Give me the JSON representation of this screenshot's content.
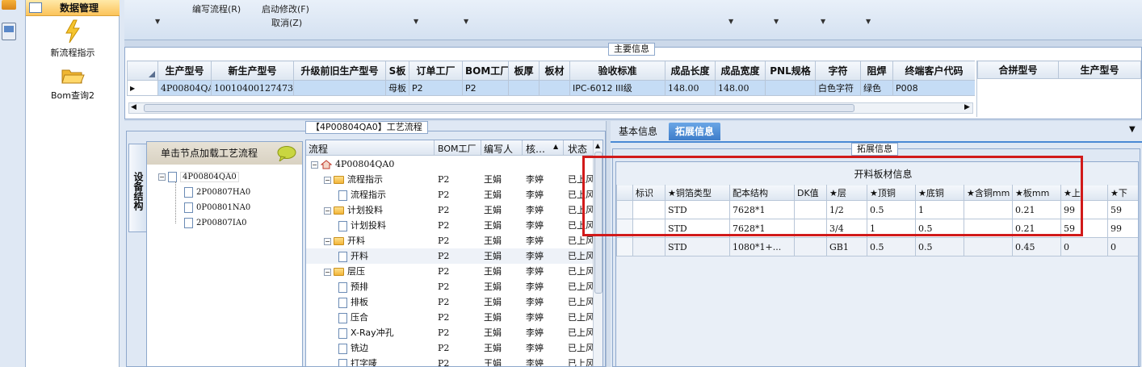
{
  "nav": {
    "header": "数据管理",
    "items": [
      {
        "label": "新流程指示",
        "icon": "lightning-icon"
      },
      {
        "label": "Bom查询2",
        "icon": "folder-open-icon"
      }
    ]
  },
  "ribbon": {
    "items": [
      "编写流程(R)",
      "启动修改(F)",
      "取消(Z)"
    ]
  },
  "main_info": {
    "title": "主要信息",
    "columns": [
      "生产型号",
      "新生产型号",
      "升级前旧生产型号",
      "S板",
      "订单工厂",
      "BOM工厂",
      "板厚",
      "板材",
      "验收标准",
      "成品长度",
      "成品宽度",
      "PNL规格",
      "字符",
      "阻焊",
      "终端客户代码"
    ],
    "row": [
      "4P00804QA0",
      "10010400127473",
      "",
      "母板",
      "P2",
      "P2",
      "",
      "",
      "IPC-6012 III级",
      "148.00",
      "148.00",
      "",
      "白色字符",
      "绿色",
      "P008"
    ],
    "right_columns": [
      "合拼型号",
      "生产型号"
    ]
  },
  "process": {
    "title": "【4P00804QA0】工艺流程",
    "side_tab": "设备结构",
    "load_label": "单击节点加载工艺流程",
    "tree_root": "4P00804QA0",
    "tree_children": [
      "2P00807HA0",
      "0P00801NA0",
      "2P00807IA0"
    ],
    "columns": [
      "流程",
      "BOM工厂",
      "编写人",
      "核…",
      "状态"
    ],
    "rows": [
      {
        "name": "4P00804QA0",
        "level": 0,
        "type": "root",
        "factory": "",
        "writer": "",
        "checker": "",
        "status": ""
      },
      {
        "name": "流程指示",
        "level": 1,
        "type": "folder",
        "factory": "P2",
        "writer": "王娟",
        "checker": "李婷",
        "status": "已上风"
      },
      {
        "name": "流程指示",
        "level": 2,
        "type": "doc",
        "factory": "P2",
        "writer": "王娟",
        "checker": "李婷",
        "status": "已上风"
      },
      {
        "name": "计划投料",
        "level": 1,
        "type": "folder",
        "factory": "P2",
        "writer": "王娟",
        "checker": "李婷",
        "status": "已上风"
      },
      {
        "name": "计划投料",
        "level": 2,
        "type": "doc",
        "factory": "P2",
        "writer": "王娟",
        "checker": "李婷",
        "status": "已上风"
      },
      {
        "name": "开料",
        "level": 1,
        "type": "folder",
        "factory": "P2",
        "writer": "王娟",
        "checker": "李婷",
        "status": "已上风"
      },
      {
        "name": "开料",
        "level": 2,
        "type": "doc",
        "factory": "P2",
        "writer": "王娟",
        "checker": "李婷",
        "status": "已上风"
      },
      {
        "name": "层压",
        "level": 1,
        "type": "folder",
        "factory": "P2",
        "writer": "王娟",
        "checker": "李婷",
        "status": "已上风"
      },
      {
        "name": "预排",
        "level": 2,
        "type": "doc",
        "factory": "P2",
        "writer": "王娟",
        "checker": "李婷",
        "status": "已上风"
      },
      {
        "name": "排板",
        "level": 2,
        "type": "doc",
        "factory": "P2",
        "writer": "王娟",
        "checker": "李婷",
        "status": "已上风"
      },
      {
        "name": "压合",
        "level": 2,
        "type": "doc",
        "factory": "P2",
        "writer": "王娟",
        "checker": "李婷",
        "status": "已上风"
      },
      {
        "name": "X-Ray冲孔",
        "level": 2,
        "type": "doc",
        "factory": "P2",
        "writer": "王娟",
        "checker": "李婷",
        "status": "已上风"
      },
      {
        "name": "铣边",
        "level": 2,
        "type": "doc",
        "factory": "P2",
        "writer": "王娟",
        "checker": "李婷",
        "status": "已上风"
      },
      {
        "name": "打字唛",
        "level": 2,
        "type": "doc",
        "factory": "P2",
        "writer": "王娟",
        "checker": "李婷",
        "status": "已上风"
      }
    ]
  },
  "ext": {
    "tabs": [
      "基本信息",
      "拓展信息"
    ],
    "group_title": "拓展信息",
    "table_title": "开料板材信息",
    "columns": [
      "标识",
      "★铜箔类型",
      "配本结构",
      "DK值",
      "★层",
      "★顶铜",
      "★底铜",
      "★含铜mm",
      "★板mm",
      "★上",
      "★下"
    ],
    "rows": [
      [
        "",
        "STD",
        "7628*1",
        "",
        "1/2",
        "0.5",
        "1",
        "",
        "0.21",
        "99",
        "59"
      ],
      [
        "",
        "STD",
        "7628*1",
        "",
        "3/4",
        "1",
        "0.5",
        "",
        "0.21",
        "59",
        "99"
      ],
      [
        "",
        "STD",
        "1080*1+...",
        "",
        "GB1",
        "0.5",
        "0.5",
        "",
        "0.45",
        "0",
        "0"
      ]
    ]
  },
  "colors": {
    "highlight": "#d11a1a",
    "selection": "#c5dcf5",
    "active_tab": "#4a8ad4"
  }
}
